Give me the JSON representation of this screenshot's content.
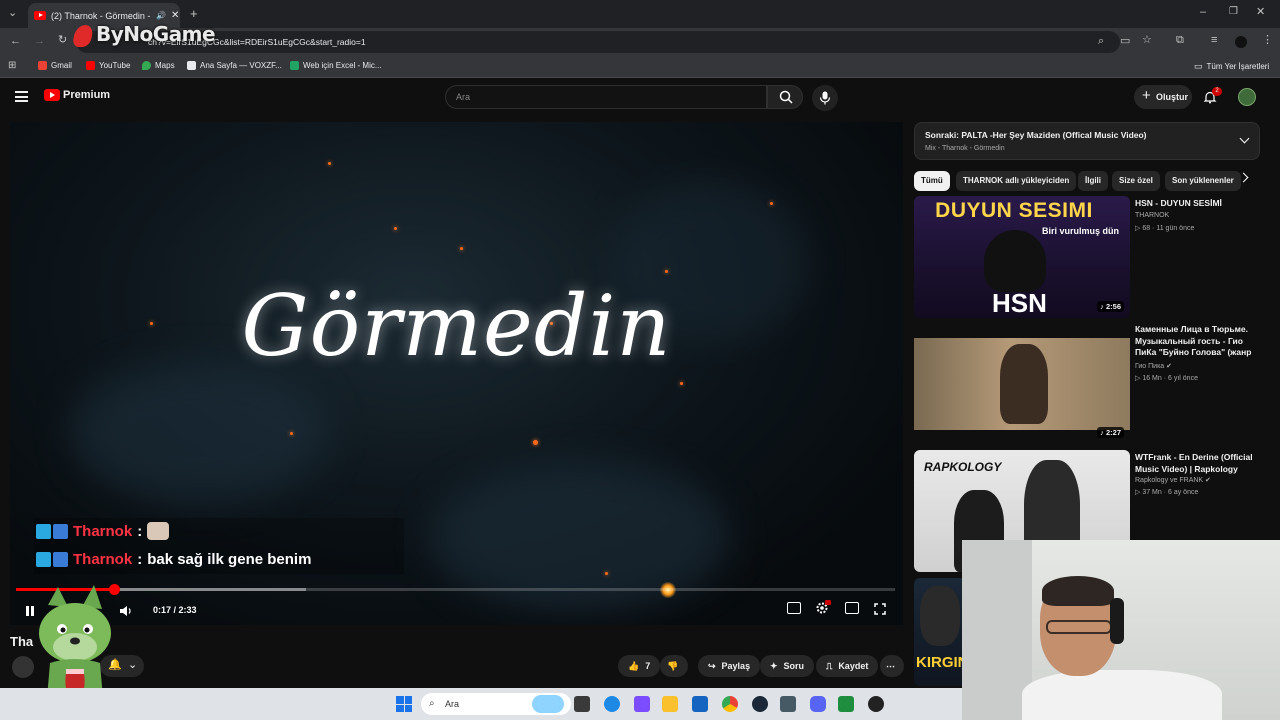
{
  "browser": {
    "tab_title": "(2) Tharnok - Görmedin - Yo",
    "url": "youtube.com/watch?v=EirS1uEgCGc&list=RDEirS1uEgCGc&start_radio=1",
    "url_prefix_obscured": "ch?v=EirS1uEgCGc&list=RDEirS1uEgCGc&start_radio=1",
    "bookmarks": [
      {
        "label": "Gmail",
        "color": "#ea4335"
      },
      {
        "label": "YouTube",
        "color": "#ff0000"
      },
      {
        "label": "Maps",
        "color": "#34a853"
      },
      {
        "label": "Ana Sayfa — VOXZF...",
        "color": "#e8eaed"
      },
      {
        "label": "Web için Excel - Mic...",
        "color": "#21a366"
      }
    ],
    "all_bookmarks": "Tüm Yer İşaretleri"
  },
  "overlay": {
    "logo_text": "ByNoGame"
  },
  "masthead": {
    "premium_label": "Premium",
    "search_placeholder": "Ara",
    "create_label": "Oluştur",
    "notification_count": "2"
  },
  "player": {
    "overlay_title": "Görmedin",
    "time": "0:17 / 2:33",
    "progress_fraction": 0.111,
    "buffer_fraction": 0.33,
    "chat": [
      {
        "name": "Tharnok",
        "sep": " :",
        "msg": ""
      },
      {
        "name": "Tharnok",
        "sep": " :",
        "msg": "bak sağ ilk gene benim"
      }
    ]
  },
  "below_player": {
    "title_fragment": "Tha",
    "like_count": "7",
    "share_label": "Paylaş",
    "ask_label": "Soru",
    "save_label": "Kaydet"
  },
  "up_next": {
    "title": "Sonraki: PALTA -Her Şey Maziden (Offical Music Video)",
    "subtitle": "Mix - Tharnok - Görmedin"
  },
  "chips": [
    "Tümü",
    "THARNOK adlı yükleyiciden",
    "İlgili",
    "Size özel",
    "Son yüklenenler"
  ],
  "recommendations": [
    {
      "title": "HSN - DUYUN SESİMİ",
      "channel": "THARNOK",
      "meta": "68 · 11 gün önce",
      "duration": "2:56",
      "thumb_text_1": "DUYUN SESIMI",
      "thumb_text_2": "Biri vurulmuş dün",
      "thumb_text_3": "HSN"
    },
    {
      "title": "Каменные Лица в Тюрьме. Музыкальный гость - Гио ПиКа \"Буйно Голова\" (жанр музык...",
      "channel": "Гио Пика",
      "meta": "16 Mn · 6 yıl önce",
      "duration": "2:27"
    },
    {
      "title": "WTFrank - En Derine (Official Music Video) | Rapkology",
      "channel": "Rapkology ve FRANK",
      "meta": "37 Mn · 6 ay önce",
      "thumb_text_1": "RAPKOLOGY"
    },
    {
      "thumb_text_1": "KIRGIN"
    }
  ],
  "taskbar": {
    "search_label": "Ara"
  }
}
